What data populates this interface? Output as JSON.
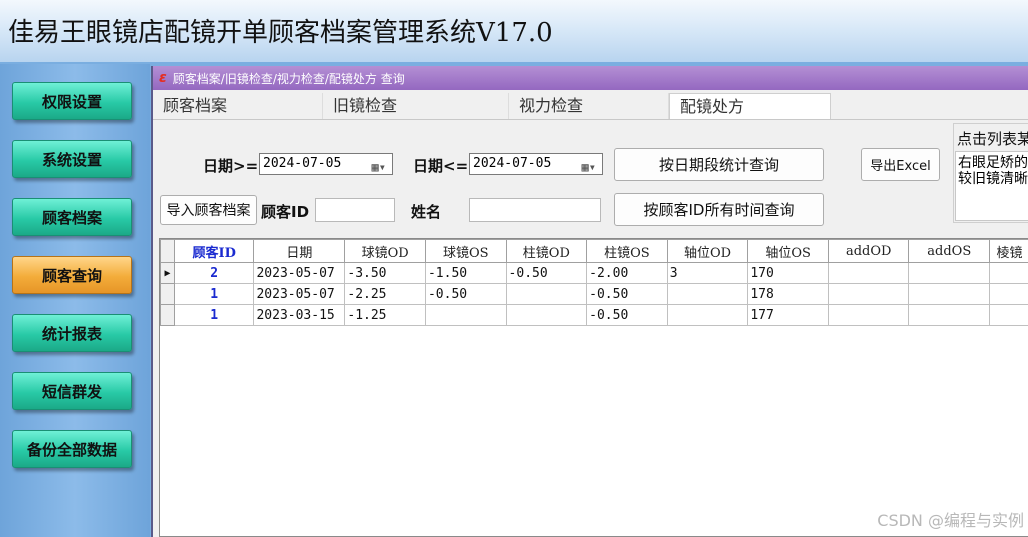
{
  "app": {
    "title": "佳易王眼镜店配镜开单顾客档案管理系统V17.0"
  },
  "sidebar": {
    "items": [
      {
        "label": "权限设置",
        "active": false
      },
      {
        "label": "系统设置",
        "active": false
      },
      {
        "label": "顾客档案",
        "active": false
      },
      {
        "label": "顾客查询",
        "active": true
      },
      {
        "label": "统计报表",
        "active": false
      },
      {
        "label": "短信群发",
        "active": false
      },
      {
        "label": "备份全部数据",
        "active": false
      }
    ]
  },
  "window": {
    "logo": "ɛ",
    "title": "顾客档案/旧镜检查/视力检查/配镜处方  查询"
  },
  "tabs": [
    {
      "label": "顾客档案",
      "active": false
    },
    {
      "label": "旧镜检查",
      "active": false
    },
    {
      "label": "视力检查",
      "active": false
    },
    {
      "label": "配镜处方",
      "active": true
    }
  ],
  "filters": {
    "date_from_label": "日期>=",
    "date_from_value": "2024-07-05",
    "date_to_label": "日期<=",
    "date_to_value": "2024-07-05",
    "query_by_date_button": "按日期段统计查询",
    "export_excel_button": "导出Excel",
    "import_customer_button": "导入顾客档案",
    "customer_id_label": "顾客ID",
    "customer_id_value": "",
    "name_label": "姓名",
    "name_value": "",
    "query_by_id_button": "按顾客ID所有时间查询",
    "hint_caption": "点击列表某",
    "hint_text": "右眼足矫的较旧镜清晰"
  },
  "grid": {
    "columns": [
      "顾客ID",
      "日期",
      "球镜OD",
      "球镜OS",
      "柱镜OD",
      "柱镜OS",
      "轴位OD",
      "轴位OS",
      "addOD",
      "addOS",
      "棱镜"
    ],
    "rows": [
      {
        "current": true,
        "cells": [
          "2",
          "2023-05-07",
          "-3.50",
          "-1.50",
          "-0.50",
          "-2.00",
          "3",
          "170",
          "",
          "",
          ""
        ]
      },
      {
        "current": false,
        "cells": [
          "1",
          "2023-05-07",
          "-2.25",
          "-0.50",
          "",
          "-0.50",
          "",
          "178",
          "",
          "",
          ""
        ]
      },
      {
        "current": false,
        "cells": [
          "1",
          "2023-03-15",
          "-1.25",
          "",
          "",
          "-0.50",
          "",
          "177",
          "",
          "",
          ""
        ]
      }
    ]
  },
  "watermark": "CSDN @编程与实例",
  "colors": {
    "nav_button": "#28c9a6",
    "nav_active": "#f3ac3a",
    "title_bar": "#9468c0",
    "id_text": "#1a2ad0"
  }
}
